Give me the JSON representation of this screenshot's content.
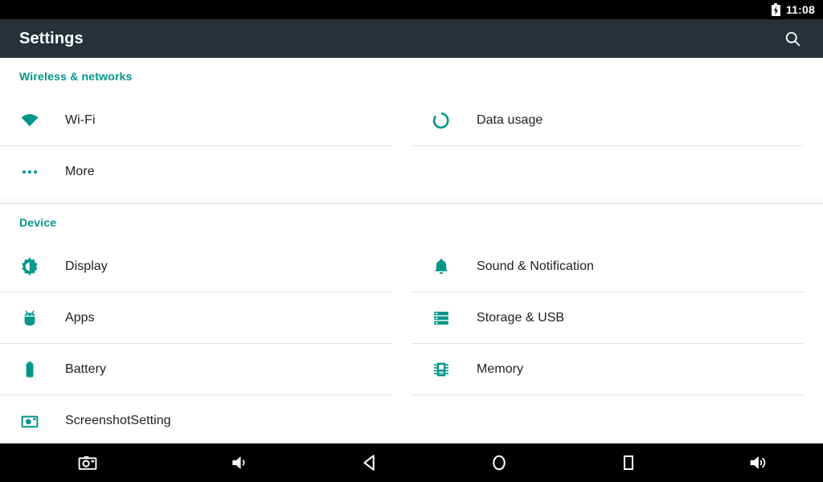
{
  "status_bar": {
    "battery_icon": "battery-charging-icon",
    "time": "11:08"
  },
  "app_bar": {
    "title": "Settings",
    "search_icon": "search-icon"
  },
  "colors": {
    "accent": "#009688",
    "app_bar": "#263238",
    "status_bar": "#000000",
    "nav_bar": "#000000",
    "background": "#ffffff",
    "label": "#212121",
    "divider": "#e4e4e4"
  },
  "sections": [
    {
      "header": "Wireless & networks",
      "rows": [
        [
          {
            "label": "Wi-Fi",
            "icon": "wifi-icon"
          },
          {
            "label": "Data usage",
            "icon": "data-usage-icon"
          }
        ],
        [
          {
            "label": "More",
            "icon": "more-dots-icon"
          },
          {
            "label": "",
            "icon": "",
            "empty": true
          }
        ]
      ]
    },
    {
      "header": "Device",
      "rows": [
        [
          {
            "label": "Display",
            "icon": "brightness-icon"
          },
          {
            "label": "Sound & Notification",
            "icon": "bell-icon"
          }
        ],
        [
          {
            "label": "Apps",
            "icon": "android-robot-icon"
          },
          {
            "label": "Storage & USB",
            "icon": "storage-icon"
          }
        ],
        [
          {
            "label": "Battery",
            "icon": "battery-icon"
          },
          {
            "label": "Memory",
            "icon": "memory-chip-icon"
          }
        ],
        [
          {
            "label": "ScreenshotSetting",
            "icon": "camera-icon"
          },
          {
            "label": "",
            "icon": "",
            "empty": true
          }
        ]
      ]
    }
  ],
  "nav_bar": {
    "buttons": [
      {
        "name": "screenshot-button",
        "icon": "camera-icon"
      },
      {
        "name": "volume-down-button",
        "icon": "volume-down-icon"
      },
      {
        "name": "back-button",
        "icon": "back-triangle-icon"
      },
      {
        "name": "home-button",
        "icon": "home-circle-icon"
      },
      {
        "name": "recents-button",
        "icon": "recents-square-icon"
      },
      {
        "name": "volume-up-button",
        "icon": "volume-up-icon"
      }
    ]
  }
}
